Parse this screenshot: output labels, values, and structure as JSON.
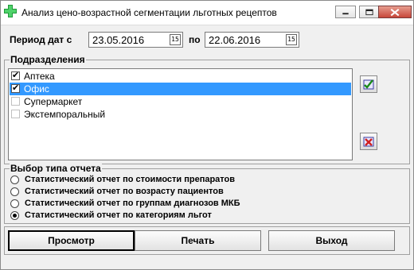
{
  "window": {
    "title": "Анализ цено-возрастной сегментации льготных рецептов"
  },
  "period": {
    "label": "Период дат с",
    "from": "23.05.2016",
    "to_label": "по",
    "to": "22.06.2016",
    "calendar_glyph": "15"
  },
  "departments": {
    "title": "Подразделения",
    "items": [
      {
        "label": "Аптека",
        "checked": true,
        "selected": false
      },
      {
        "label": "Офис",
        "checked": true,
        "selected": true
      },
      {
        "label": "Супермаркет",
        "checked": false,
        "selected": false
      },
      {
        "label": "Экстемпоральный",
        "checked": false,
        "selected": false
      }
    ],
    "check_mark": "✔"
  },
  "report_type": {
    "title": "Выбор типа отчета",
    "options": [
      {
        "label": "Статистический отчет по стоимости препаратов",
        "selected": false
      },
      {
        "label": "Статистический отчет по возрасту пациентов",
        "selected": false
      },
      {
        "label": "Статистический отчет по группам диагнозов МКБ",
        "selected": false
      },
      {
        "label": "Статистический отчет по категориям льгот",
        "selected": true
      }
    ]
  },
  "buttons": {
    "view": "Просмотр",
    "print": "Печать",
    "exit": "Выход"
  },
  "colors": {
    "selection": "#3399ff",
    "close_button": "#c7463a",
    "app_icon": "#1f9a3a"
  }
}
